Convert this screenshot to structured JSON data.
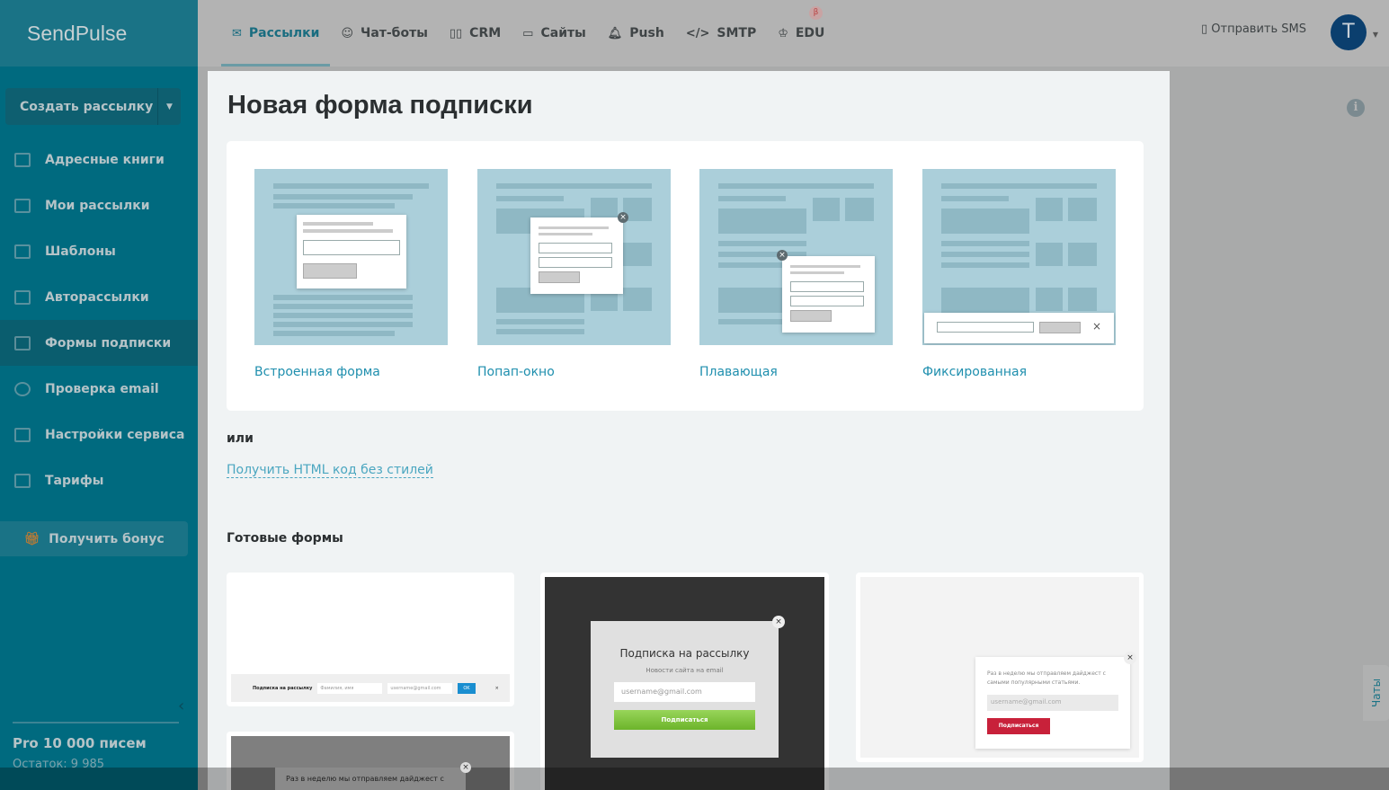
{
  "logo": "SendPulse",
  "sidebar": {
    "create_label": "Создать рассылку",
    "items": [
      {
        "label": "Адресные книги",
        "icon": "address-book-icon"
      },
      {
        "label": "Мои рассылки",
        "icon": "mailings-icon"
      },
      {
        "label": "Шаблоны",
        "icon": "templates-icon"
      },
      {
        "label": "Авторассылки",
        "icon": "automation-icon"
      },
      {
        "label": "Формы подписки",
        "icon": "forms-icon",
        "active": true
      },
      {
        "label": "Проверка email",
        "icon": "check-icon"
      },
      {
        "label": "Настройки сервиса",
        "icon": "settings-icon"
      },
      {
        "label": "Тарифы",
        "icon": "pricing-icon"
      }
    ],
    "bonus_label": "Получить бонус",
    "plan": "Pro 10 000 писем",
    "remaining": "Остаток: 9 985"
  },
  "header": {
    "tabs": [
      {
        "label": "Рассылки",
        "icon": "mail-icon"
      },
      {
        "label": "Чат-боты",
        "icon": "chat-icon"
      },
      {
        "label": "CRM",
        "icon": "crm-icon"
      },
      {
        "label": "Сайты",
        "icon": "sites-icon"
      },
      {
        "label": "Push",
        "icon": "bell-icon"
      },
      {
        "label": "SMTP",
        "icon": "code-icon"
      },
      {
        "label": "EDU",
        "icon": "edu-icon"
      }
    ],
    "beta": "β",
    "sms_label": "Отправить SMS",
    "avatar": "T"
  },
  "chats_label": "Чаты",
  "modal": {
    "title": "Новая форма подписки",
    "types": [
      "Встроенная форма",
      "Попап-окно",
      "Плавающая",
      "Фиксированная"
    ],
    "or": "или",
    "html_link": "Получить HTML код без стилей",
    "ready_title": "Готовые формы",
    "ready": {
      "f1": {
        "title": "Подписка на рассылку",
        "name_ph": "Фамилия, имя",
        "email_ph": "username@gmail.com",
        "button": "OK"
      },
      "f2": {
        "title": "Подписка на рассылку",
        "subtitle": "Новости сайта на email",
        "email_ph": "username@gmail.com",
        "button": "Подписаться"
      },
      "f3": {
        "text": "Раз в неделю мы отправляем дайджест с самыми популярными статьями.",
        "email_ph": "username@gmail.com",
        "button": "Подписаться"
      },
      "f4": {
        "text": "Раз в неделю мы отправляем дайджест с"
      }
    }
  }
}
